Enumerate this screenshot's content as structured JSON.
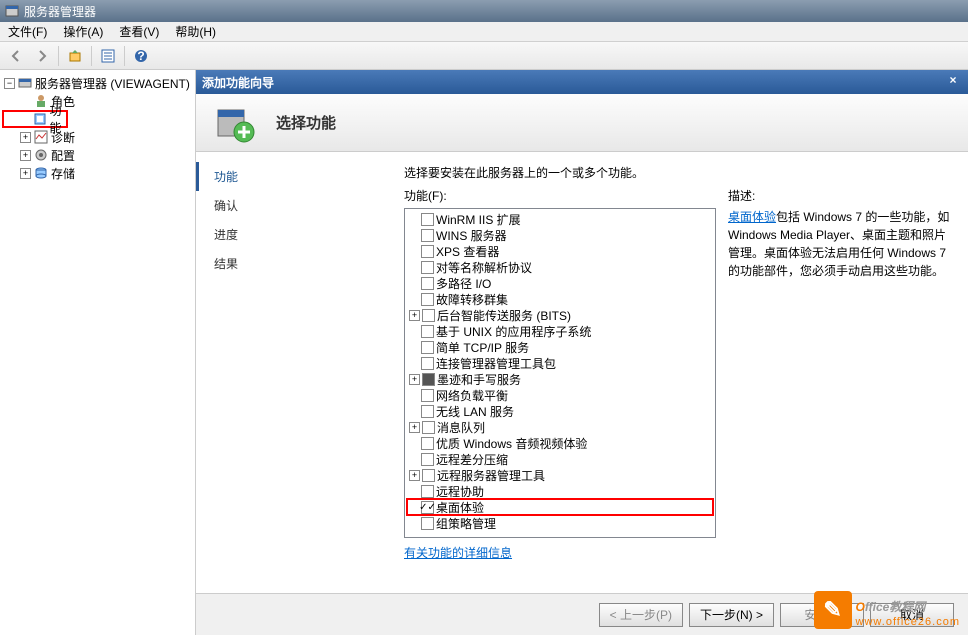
{
  "title": "服务器管理器",
  "menu": {
    "file": "文件(F)",
    "action": "操作(A)",
    "view": "查看(V)",
    "help": "帮助(H)"
  },
  "tree": {
    "root": "服务器管理器 (VIEWAGENT)",
    "roles": "角色",
    "features": "功能",
    "diagnostics": "诊断",
    "config": "配置",
    "storage": "存储"
  },
  "wizard": {
    "title": "添加功能向导",
    "heading": "选择功能",
    "steps": {
      "features": "功能",
      "confirm": "确认",
      "progress": "进度",
      "results": "结果"
    },
    "prompt": "选择要安装在此服务器上的一个或多个功能。",
    "label": "功能(F):",
    "desc_label": "描述:",
    "desc_link": "桌面体验",
    "desc_text": "包括 Windows 7 的一些功能，如 Windows Media Player、桌面主题和照片管理。桌面体验无法启用任何 Windows 7 的功能部件，您必须手动启用这些功能。",
    "more_link": "有关功能的详细信息",
    "buttons": {
      "prev": "< 上一步(P)",
      "next": "下一步(N) >",
      "install": "安装(I)",
      "cancel": "取消"
    },
    "features_list": [
      {
        "label": "WinRM IIS 扩展"
      },
      {
        "label": "WINS 服务器"
      },
      {
        "label": "XPS 查看器"
      },
      {
        "label": "对等名称解析协议"
      },
      {
        "label": "多路径 I/O"
      },
      {
        "label": "故障转移群集"
      },
      {
        "label": "后台智能传送服务 (BITS)",
        "exp": true
      },
      {
        "label": "基于 UNIX 的应用程序子系统"
      },
      {
        "label": "简单 TCP/IP 服务"
      },
      {
        "label": "连接管理器管理工具包"
      },
      {
        "label": "墨迹和手写服务",
        "filled": true,
        "exp": true
      },
      {
        "label": "网络负载平衡"
      },
      {
        "label": "无线 LAN 服务"
      },
      {
        "label": "消息队列",
        "exp": true
      },
      {
        "label": "优质 Windows 音频视频体验"
      },
      {
        "label": "远程差分压缩"
      },
      {
        "label": "远程服务器管理工具",
        "exp": true
      },
      {
        "label": "远程协助"
      },
      {
        "label": "桌面体验",
        "checked": true,
        "highlight": true
      },
      {
        "label": "组策略管理"
      }
    ]
  },
  "watermark": {
    "brand1": "O",
    "brand2": "ffice",
    "brand3": "教程网",
    "url": "www.office26.com"
  }
}
